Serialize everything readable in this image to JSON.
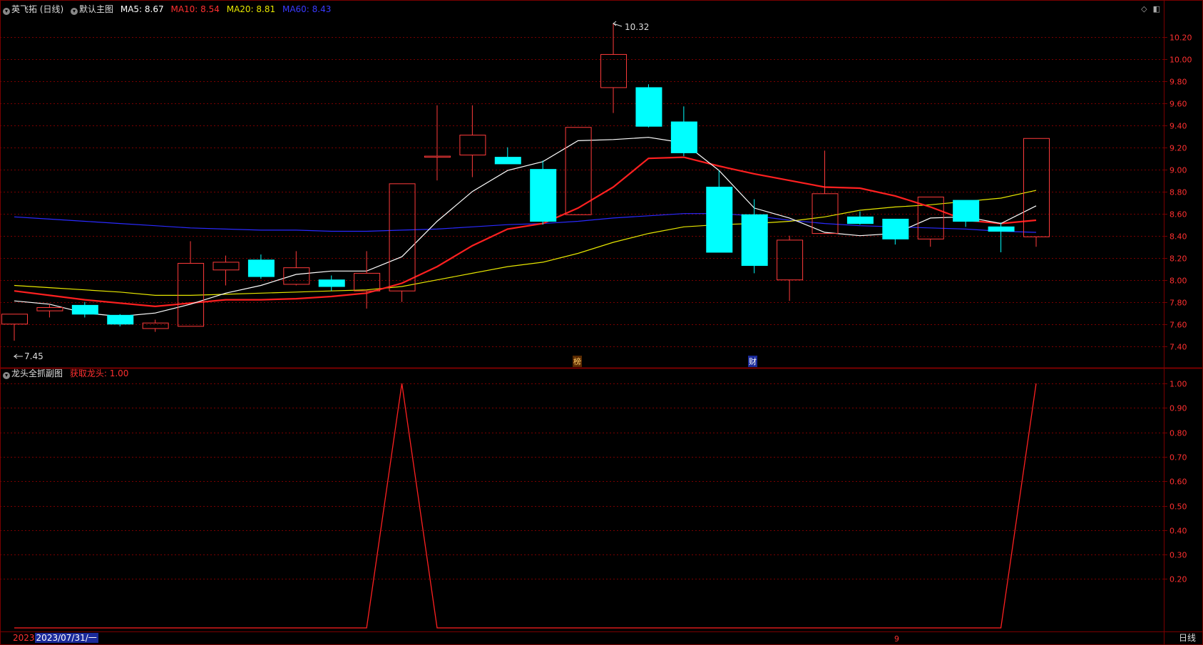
{
  "main_legend": {
    "stock": "英飞拓 (日线)",
    "chart_name": "默认主图",
    "ma5": "MA5: 8.67",
    "ma10": "MA10: 8.54",
    "ma20": "MA20: 8.81",
    "ma60": "MA60: 8.43"
  },
  "sub_legend": {
    "name": "龙头全抓副图",
    "value": "获取龙头: 1.00"
  },
  "markers": {
    "bang": "榜",
    "cai": "财"
  },
  "footer": {
    "year": "2023",
    "date": "2023/07/31/一",
    "tick": "9",
    "period": "日线"
  },
  "annotations": {
    "high": "10.32",
    "low": "7.45"
  },
  "colors": {
    "up": "#ff3b3b",
    "down": "#00ffff",
    "ma5": "#ffffff",
    "ma10": "#ff2020",
    "ma20": "#e6e600",
    "ma60": "#2a2aff",
    "grid": "#7a0000"
  },
  "chart_data": [
    {
      "type": "candlestick",
      "y_ticks": [
        "10.20",
        "10.00",
        "9.80",
        "9.60",
        "9.40",
        "9.20",
        "9.00",
        "8.80",
        "8.60",
        "8.40",
        "8.20",
        "8.00",
        "7.80",
        "7.60",
        "7.40"
      ],
      "ylim": [
        7.38,
        10.37
      ],
      "candles": [
        {
          "o": 7.6,
          "c": 7.69,
          "h": 7.69,
          "l": 7.45
        },
        {
          "o": 7.72,
          "c": 7.75,
          "h": 7.78,
          "l": 7.66
        },
        {
          "o": 7.77,
          "c": 7.69,
          "h": 7.8,
          "l": 7.66
        },
        {
          "o": 7.68,
          "c": 7.6,
          "h": 7.69,
          "l": 7.58
        },
        {
          "o": 7.56,
          "c": 7.61,
          "h": 7.64,
          "l": 7.53
        },
        {
          "o": 7.58,
          "c": 8.15,
          "h": 8.35,
          "l": 7.58
        },
        {
          "o": 8.09,
          "c": 8.16,
          "h": 8.22,
          "l": 7.95
        },
        {
          "o": 8.18,
          "c": 8.03,
          "h": 8.23,
          "l": 8.01
        },
        {
          "o": 7.96,
          "c": 8.11,
          "h": 8.26,
          "l": 7.95
        },
        {
          "o": 8.0,
          "c": 7.94,
          "h": 8.04,
          "l": 7.9
        },
        {
          "o": 7.9,
          "c": 8.06,
          "h": 8.26,
          "l": 7.74
        },
        {
          "o": 7.9,
          "c": 8.87,
          "h": 8.87,
          "l": 7.8
        },
        {
          "o": 9.11,
          "c": 9.12,
          "h": 9.58,
          "l": 8.9
        },
        {
          "o": 9.13,
          "c": 9.31,
          "h": 9.58,
          "l": 8.93
        },
        {
          "o": 9.11,
          "c": 9.05,
          "h": 9.2,
          "l": 9.05
        },
        {
          "o": 9.0,
          "c": 8.53,
          "h": 9.08,
          "l": 8.5
        },
        {
          "o": 8.59,
          "c": 9.38,
          "h": 9.38,
          "l": 8.59
        },
        {
          "o": 9.74,
          "c": 10.04,
          "h": 10.32,
          "l": 9.51
        },
        {
          "o": 9.74,
          "c": 9.39,
          "h": 9.77,
          "l": 9.38
        },
        {
          "o": 9.43,
          "c": 9.15,
          "h": 9.57,
          "l": 9.12
        },
        {
          "o": 8.84,
          "c": 8.25,
          "h": 8.99,
          "l": 8.25
        },
        {
          "o": 8.59,
          "c": 8.13,
          "h": 8.73,
          "l": 8.06
        },
        {
          "o": 8.0,
          "c": 8.36,
          "h": 8.4,
          "l": 7.81
        },
        {
          "o": 8.42,
          "c": 8.78,
          "h": 9.17,
          "l": 8.42
        },
        {
          "o": 8.57,
          "c": 8.51,
          "h": 8.62,
          "l": 8.5
        },
        {
          "o": 8.55,
          "c": 8.37,
          "h": 8.55,
          "l": 8.32
        },
        {
          "o": 8.37,
          "c": 8.75,
          "h": 8.75,
          "l": 8.3
        },
        {
          "o": 8.72,
          "c": 8.53,
          "h": 8.72,
          "l": 8.48
        },
        {
          "o": 8.48,
          "c": 8.44,
          "h": 8.52,
          "l": 8.25
        },
        {
          "o": 8.39,
          "c": 9.28,
          "h": 9.28,
          "l": 8.3
        }
      ],
      "ma5": [
        7.81,
        7.78,
        7.7,
        7.67,
        7.7,
        7.78,
        7.88,
        7.95,
        8.05,
        8.08,
        8.08,
        8.21,
        8.53,
        8.8,
        8.99,
        9.07,
        9.26,
        9.27,
        9.29,
        9.24,
        8.99,
        8.65,
        8.56,
        8.43,
        8.4,
        8.42,
        8.56,
        8.57,
        8.51,
        8.67
      ],
      "ma10": [
        7.9,
        7.86,
        7.82,
        7.79,
        7.76,
        7.79,
        7.82,
        7.82,
        7.83,
        7.85,
        7.88,
        7.97,
        8.12,
        8.31,
        8.46,
        8.51,
        8.65,
        8.84,
        9.1,
        9.11,
        9.03,
        8.96,
        8.9,
        8.84,
        8.83,
        8.76,
        8.66,
        8.54,
        8.51,
        8.54
      ],
      "ma20": [
        7.95,
        7.93,
        7.91,
        7.89,
        7.86,
        7.86,
        7.87,
        7.88,
        7.89,
        7.9,
        7.91,
        7.94,
        8.0,
        8.06,
        8.12,
        8.16,
        8.24,
        8.34,
        8.42,
        8.48,
        8.5,
        8.51,
        8.53,
        8.57,
        8.63,
        8.66,
        8.68,
        8.71,
        8.74,
        8.81
      ],
      "ma60": [
        8.57,
        8.55,
        8.53,
        8.51,
        8.49,
        8.47,
        8.46,
        8.45,
        8.45,
        8.44,
        8.44,
        8.45,
        8.46,
        8.48,
        8.5,
        8.51,
        8.53,
        8.56,
        8.58,
        8.6,
        8.6,
        8.58,
        8.54,
        8.51,
        8.49,
        8.48,
        8.47,
        8.46,
        8.44,
        8.43
      ]
    },
    {
      "type": "line",
      "name": "获取龙头",
      "y_ticks": [
        "1.00",
        "0.90",
        "0.80",
        "0.70",
        "0.60",
        "0.50",
        "0.40",
        "0.30",
        "0.20"
      ],
      "ylim": [
        0,
        1
      ],
      "values": [
        0,
        0,
        0,
        0,
        0,
        0,
        0,
        0,
        0,
        0,
        0,
        1,
        0,
        0,
        0,
        0,
        0,
        0,
        0,
        0,
        0,
        0,
        0,
        0,
        0,
        0,
        0,
        0,
        0,
        1
      ]
    }
  ]
}
